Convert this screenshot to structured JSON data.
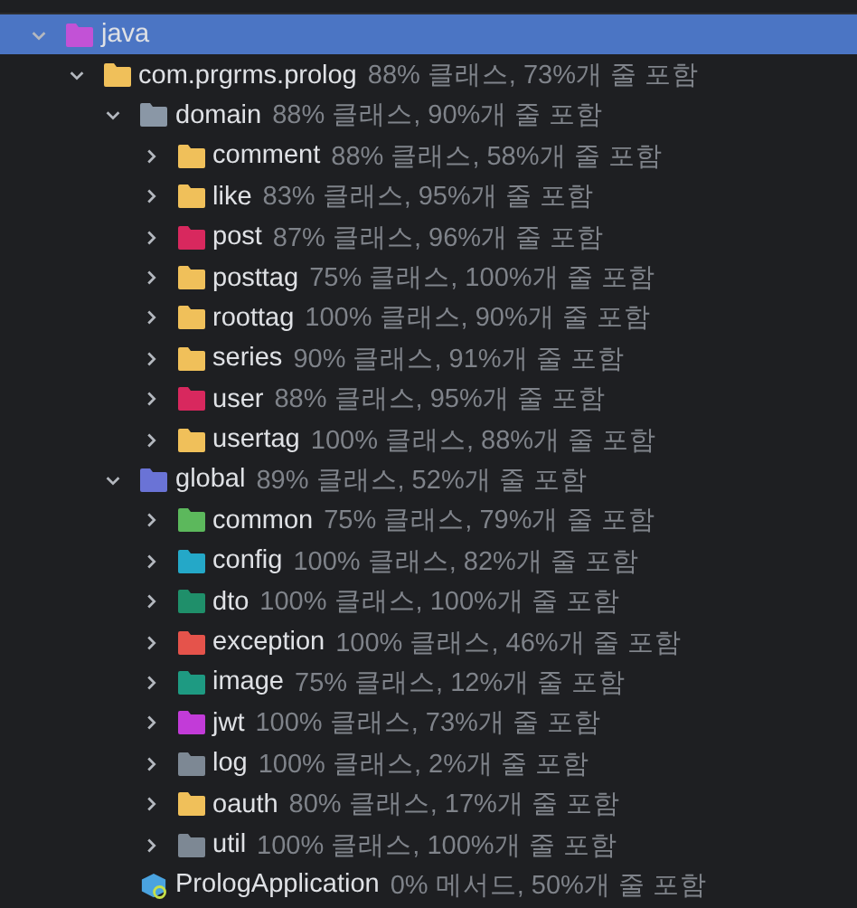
{
  "tree": [
    {
      "name": "java",
      "kind": "folder",
      "color": "#c252d6",
      "expanded": true,
      "selected": true,
      "children": [
        {
          "name": "com.prgrms.prolog",
          "coverage": "88% 클래스, 73%개 줄 포함",
          "kind": "folder",
          "color": "#f0c05a",
          "expanded": true,
          "selected": false,
          "children": [
            {
              "name": "domain",
              "coverage": "88% 클래스, 90%개 줄 포함",
              "kind": "folder",
              "color": "#8a97a6",
              "expanded": true,
              "selected": false,
              "children": [
                {
                  "name": "comment",
                  "coverage": "88% 클래스, 58%개 줄 포함",
                  "kind": "folder",
                  "color": "#f0c05a",
                  "expanded": false,
                  "selected": false
                },
                {
                  "name": "like",
                  "coverage": "83% 클래스, 95%개 줄 포함",
                  "kind": "folder",
                  "color": "#f0c05a",
                  "expanded": false,
                  "selected": false
                },
                {
                  "name": "post",
                  "coverage": "87% 클래스, 96%개 줄 포함",
                  "kind": "folder",
                  "color": "#d8285e",
                  "expanded": false,
                  "selected": false
                },
                {
                  "name": "posttag",
                  "coverage": "75% 클래스, 100%개 줄 포함",
                  "kind": "folder",
                  "color": "#f0c05a",
                  "expanded": false,
                  "selected": false
                },
                {
                  "name": "roottag",
                  "coverage": "100% 클래스, 90%개 줄 포함",
                  "kind": "folder",
                  "color": "#f0c05a",
                  "expanded": false,
                  "selected": false
                },
                {
                  "name": "series",
                  "coverage": "90% 클래스, 91%개 줄 포함",
                  "kind": "folder",
                  "color": "#f0c05a",
                  "expanded": false,
                  "selected": false
                },
                {
                  "name": "user",
                  "coverage": "88% 클래스, 95%개 줄 포함",
                  "kind": "folder",
                  "color": "#d8285e",
                  "expanded": false,
                  "selected": false
                },
                {
                  "name": "usertag",
                  "coverage": "100% 클래스, 88%개 줄 포함",
                  "kind": "folder",
                  "color": "#f0c05a",
                  "expanded": false,
                  "selected": false
                }
              ]
            },
            {
              "name": "global",
              "coverage": "89% 클래스, 52%개 줄 포함",
              "kind": "folder",
              "color": "#6a73d6",
              "expanded": true,
              "selected": false,
              "children": [
                {
                  "name": "common",
                  "coverage": "75% 클래스, 79%개 줄 포함",
                  "kind": "folder",
                  "color": "#5cb85c",
                  "expanded": false,
                  "selected": false
                },
                {
                  "name": "config",
                  "coverage": "100% 클래스, 82%개 줄 포함",
                  "kind": "folder",
                  "color": "#24a8c8",
                  "expanded": false,
                  "selected": false
                },
                {
                  "name": "dto",
                  "coverage": "100% 클래스, 100%개 줄 포함",
                  "kind": "folder",
                  "color": "#1f8f6a",
                  "expanded": false,
                  "selected": false
                },
                {
                  "name": "exception",
                  "coverage": "100% 클래스, 46%개 줄 포함",
                  "kind": "folder",
                  "color": "#e5534b",
                  "expanded": false,
                  "selected": false
                },
                {
                  "name": "image",
                  "coverage": "75% 클래스, 12%개 줄 포함",
                  "kind": "folder",
                  "color": "#1e9a82",
                  "expanded": false,
                  "selected": false
                },
                {
                  "name": "jwt",
                  "coverage": "100% 클래스, 73%개 줄 포함",
                  "kind": "folder",
                  "color": "#c23bd8",
                  "expanded": false,
                  "selected": false
                },
                {
                  "name": "log",
                  "coverage": "100% 클래스, 2%개 줄 포함",
                  "kind": "folder",
                  "color": "#7d8894",
                  "expanded": false,
                  "selected": false
                },
                {
                  "name": "oauth",
                  "coverage": "80% 클래스, 17%개 줄 포함",
                  "kind": "folder",
                  "color": "#f0c05a",
                  "expanded": false,
                  "selected": false
                },
                {
                  "name": "util",
                  "coverage": "100% 클래스, 100%개 줄 포함",
                  "kind": "folder",
                  "color": "#7d8894",
                  "expanded": false,
                  "selected": false
                }
              ]
            },
            {
              "name": "PrologApplication",
              "coverage": "0% 메서드, 50%개 줄 포함",
              "kind": "class",
              "selected": false
            }
          ]
        }
      ]
    }
  ]
}
